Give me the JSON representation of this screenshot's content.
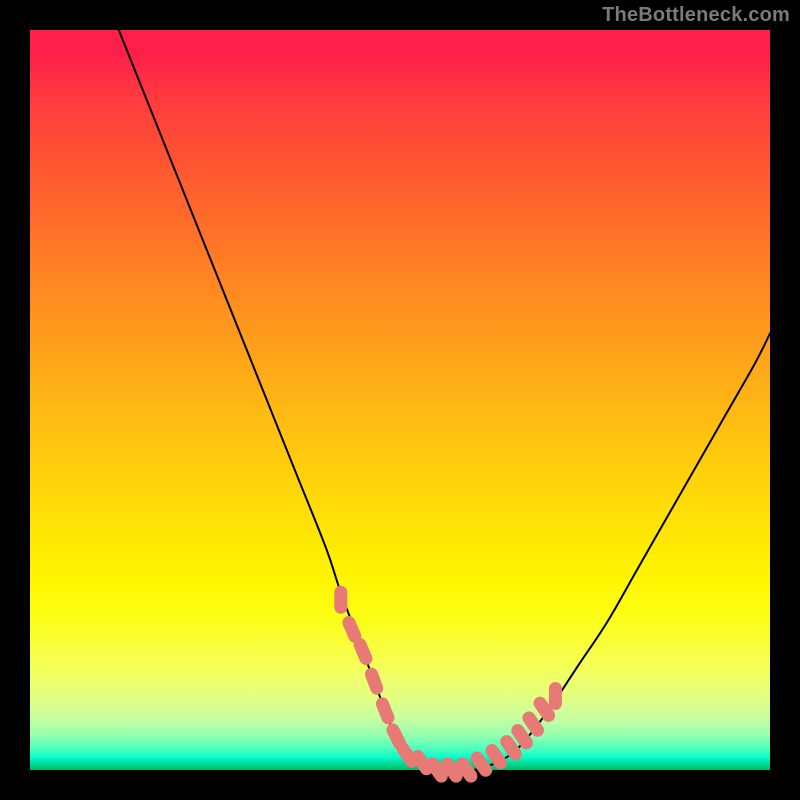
{
  "attribution": "TheBottleneck.com",
  "colors": {
    "background": "#000000",
    "curve_stroke": "#000000",
    "marker_fill": "#e77a75",
    "gradient_top": "#ff1f4a",
    "gradient_bottom": "#00b95b"
  },
  "chart_data": {
    "type": "line",
    "title": "",
    "xlabel": "",
    "ylabel": "",
    "xlim": [
      0,
      100
    ],
    "ylim": [
      0,
      100
    ],
    "grid": false,
    "legend": false,
    "series": [
      {
        "name": "bottleneck-curve",
        "x": [
          12,
          16,
          20,
          24,
          28,
          32,
          36,
          40,
          42,
          45,
          48,
          50,
          52,
          55,
          58,
          60,
          63,
          66,
          70,
          74,
          78,
          82,
          86,
          90,
          94,
          98,
          100
        ],
        "values": [
          100,
          90,
          80,
          70,
          60,
          50,
          40,
          30,
          24,
          16,
          8,
          3,
          1,
          0,
          0,
          0,
          1,
          3,
          8,
          14,
          20,
          27,
          34,
          41,
          48,
          55,
          59
        ]
      }
    ],
    "markers": {
      "name": "highlighted-range",
      "x": [
        42,
        43.5,
        45,
        46.5,
        48,
        49.5,
        51,
        53,
        55,
        57,
        59,
        61,
        63,
        65,
        66.5,
        68,
        69.5,
        71
      ],
      "values": [
        23,
        19,
        16,
        12,
        8,
        4.5,
        2,
        1,
        0,
        0,
        0,
        0.8,
        1.8,
        3,
        4.5,
        6.2,
        8.2,
        10
      ]
    }
  }
}
